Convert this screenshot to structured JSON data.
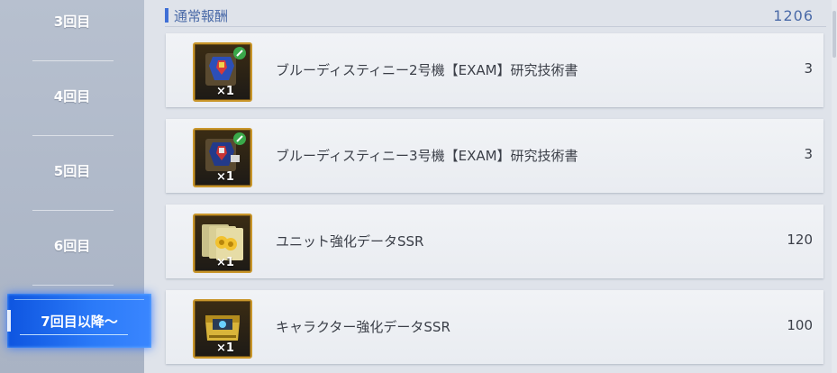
{
  "sidebar": {
    "items": [
      {
        "label": "3回目"
      },
      {
        "label": "4回目"
      },
      {
        "label": "5回目"
      },
      {
        "label": "6回目"
      }
    ],
    "active": {
      "label": "7回目以降～"
    }
  },
  "header": {
    "title": "通常報酬",
    "count": "1206"
  },
  "rewards": [
    {
      "name": "ブルーディスティニー2号機【EXAM】研究技術書",
      "count": "3",
      "qty": "×1",
      "icon": "mobile-suit-tech-book-icon"
    },
    {
      "name": "ブルーディスティニー3号機【EXAM】研究技術書",
      "count": "3",
      "qty": "×1",
      "icon": "mobile-suit-tech-book-icon"
    },
    {
      "name": "ユニット強化データSSR",
      "count": "120",
      "qty": "×1",
      "icon": "unit-data-cards-icon"
    },
    {
      "name": "キャラクター強化データSSR",
      "count": "100",
      "qty": "×1",
      "icon": "character-data-case-icon"
    }
  ],
  "colors": {
    "accent": "#3f6fd6",
    "active_tab": "#1f66f0",
    "frame_gold": "#c9962b"
  }
}
